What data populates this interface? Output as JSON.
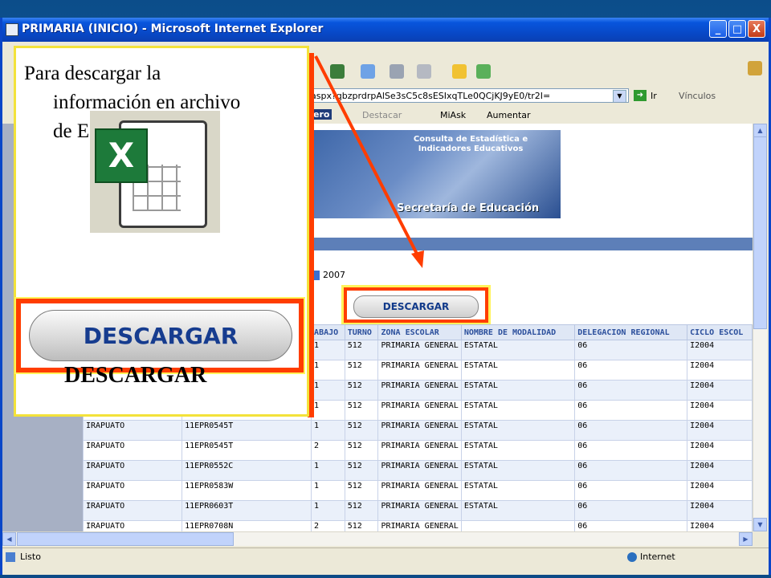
{
  "window": {
    "title": "PRIMARIA (INICIO) - Microsoft Internet Explorer",
    "controls": {
      "minimize": "_",
      "maximize": "□",
      "close": "X"
    }
  },
  "address": {
    "url": "aspx?qbzprdrpAlSe3sC5c8sESIxqTLe0QCjKJ9yE0/tr2I=",
    "go_label": "Ir",
    "links_label": "Vínculos"
  },
  "toolbar2": {
    "destacar": "Destacar",
    "miask": "MiAsk",
    "aumentar": "Aumentar",
    "logo": "ero"
  },
  "banner": {
    "line1": "Consulta de Estadística e Indicadores Educativos",
    "line2": "Secretaría de Educación"
  },
  "filter": {
    "year": "2007"
  },
  "download_button": "DESCARGAR",
  "table": {
    "headers": [
      "",
      "",
      "ABAJO",
      "TURNO",
      "ZONA ESCOLAR",
      "NOMBRE DE MODALIDAD",
      "DELEGACION REGIONAL",
      "CICLO ESCOL"
    ],
    "rows": [
      [
        "",
        "",
        "1",
        "512",
        "PRIMARIA GENERAL",
        "ESTATAL",
        "06",
        "I2004"
      ],
      [
        "",
        "",
        "1",
        "512",
        "PRIMARIA GENERAL",
        "ESTATAL",
        "06",
        "I2004"
      ],
      [
        "",
        "",
        "1",
        "512",
        "PRIMARIA GENERAL",
        "ESTATAL",
        "06",
        "I2004"
      ],
      [
        "",
        "",
        "1",
        "512",
        "PRIMARIA GENERAL",
        "ESTATAL",
        "06",
        "I2004"
      ],
      [
        "IRAPUATO",
        "11EPR0545T",
        "1",
        "512",
        "PRIMARIA GENERAL",
        "ESTATAL",
        "06",
        "I2004"
      ],
      [
        "IRAPUATO",
        "11EPR0545T",
        "2",
        "512",
        "PRIMARIA GENERAL",
        "ESTATAL",
        "06",
        "I2004"
      ],
      [
        "IRAPUATO",
        "11EPR0552C",
        "1",
        "512",
        "PRIMARIA GENERAL",
        "ESTATAL",
        "06",
        "I2004"
      ],
      [
        "IRAPUATO",
        "11EPR0583W",
        "1",
        "512",
        "PRIMARIA GENERAL",
        "ESTATAL",
        "06",
        "I2004"
      ],
      [
        "IRAPUATO",
        "11EPR0603T",
        "1",
        "512",
        "PRIMARIA GENERAL",
        "ESTATAL",
        "06",
        "I2004"
      ],
      [
        "IRAPUATO",
        "11EPR0708N",
        "2",
        "512",
        "PRIMARIA GENERAL",
        "",
        "06",
        "I2004"
      ]
    ]
  },
  "status": {
    "left": "Listo",
    "zone": "Internet"
  },
  "overlay": {
    "line1": "Para descargar la",
    "line2": "información en archivo",
    "line3": "de E",
    "button": "DESCARGAR",
    "footer": "DESCARGAR"
  },
  "colors": {
    "highlight": "#ff3d00",
    "frame": "#f3e23a",
    "xp_blue": "#0855dd",
    "excel_green": "#1d7a3a"
  }
}
